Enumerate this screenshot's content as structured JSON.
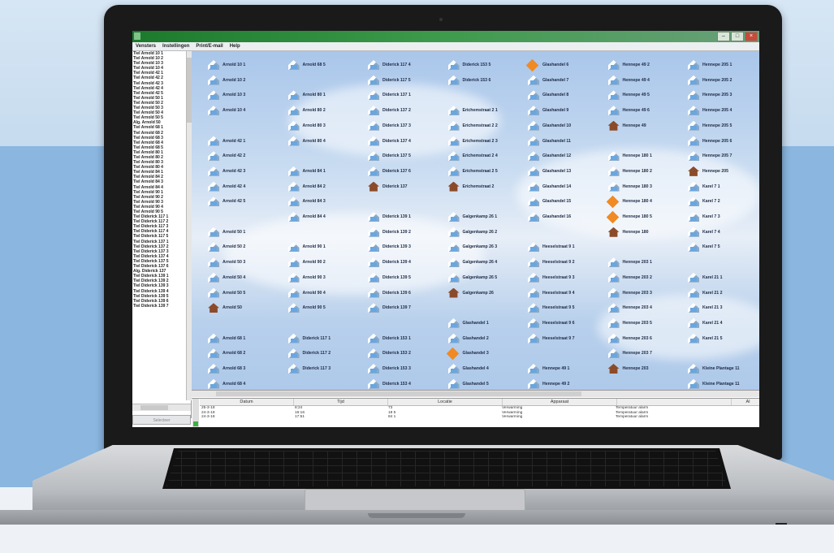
{
  "menu": [
    "Vensters",
    "Instellingen",
    "Print/E-mail",
    "Help"
  ],
  "sidebar": {
    "items": [
      "Tiel Arnold 10 1",
      "Tiel Arnold 10 2",
      "Tiel Arnold 10 3",
      "Tiel Arnold 10 4",
      "Tiel Arnold 42 1",
      "Tiel Arnold 42 2",
      "Tiel Arnold 42 3",
      "Tiel Arnold 42 4",
      "Tiel Arnold 42 5",
      "Tiel Arnold 50 1",
      "Tiel Arnold 50 2",
      "Tiel Arnold 50 3",
      "Tiel Arnold 50 4",
      "Tiel Arnold 50 5",
      "Alg. Arnold 50",
      "Tiel Arnold 68 1",
      "Tiel Arnold 68 2",
      "Tiel Arnold 68 3",
      "Tiel Arnold 68 4",
      "Tiel Arnold 68 5",
      "Tiel Arnold 80 1",
      "Tiel Arnold 80 2",
      "Tiel Arnold 80 3",
      "Tiel Arnold 80 4",
      "Tiel Arnold 84 1",
      "Tiel Arnold 84 2",
      "Tiel Arnold 84 3",
      "Tiel Arnold 84 4",
      "Tiel Arnold 90 1",
      "Tiel Arnold 90 2",
      "Tiel Arnold 90 3",
      "Tiel Arnold 90 4",
      "Tiel Arnold 90 5",
      "Tiel Diderick 117 1",
      "Tiel Diderick 117 2",
      "Tiel Diderick 117 3",
      "Tiel Diderick 117 4",
      "Tiel Diderick 117 5",
      "Tiel Diderick 137 1",
      "Tiel Diderick 137 2",
      "Tiel Diderick 137 3",
      "Tiel Diderick 137 4",
      "Tiel Diderick 137 5",
      "Tiel Diderick 137 6",
      "Alg. Diderick 137",
      "Tiel Diderick 139 1",
      "Tiel Diderick 139 2",
      "Tiel Diderick 139 3",
      "Tiel Diderick 139 4",
      "Tiel Diderick 139 5",
      "Tiel Diderick 139 6",
      "Tiel Diderick 139 7"
    ],
    "select_button": "Selecteer"
  },
  "grid": {
    "columns": [
      {
        "cells": [
          {
            "label": "Arnold 10 1",
            "icon": "roof-icon"
          },
          {
            "label": "Arnold 10 2",
            "icon": "roof-icon"
          },
          {
            "label": "Arnold 10 3",
            "icon": "roof-icon"
          },
          {
            "label": "Arnold 10 4",
            "icon": "roof-icon"
          },
          {
            "label": "",
            "icon": ""
          },
          {
            "label": "Arnold 42 1",
            "icon": "roof-icon"
          },
          {
            "label": "Arnold 42 2",
            "icon": "roof-icon"
          },
          {
            "label": "Arnold 42 3",
            "icon": "roof-icon"
          },
          {
            "label": "Arnold 42 4",
            "icon": "roof-icon"
          },
          {
            "label": "Arnold 42 5",
            "icon": "roof-icon"
          },
          {
            "label": "",
            "icon": ""
          },
          {
            "label": "Arnold 50 1",
            "icon": "roof-icon"
          },
          {
            "label": "Arnold 50 2",
            "icon": "roof-icon"
          },
          {
            "label": "Arnold 50 3",
            "icon": "roof-icon"
          },
          {
            "label": "Arnold 50 4",
            "icon": "roof-icon"
          },
          {
            "label": "Arnold 50 5",
            "icon": "roof-icon"
          },
          {
            "label": "Arnold 50",
            "icon": "house-icon"
          },
          {
            "label": "",
            "icon": ""
          },
          {
            "label": "Arnold 68 1",
            "icon": "roof-icon"
          },
          {
            "label": "Arnold 68 2",
            "icon": "roof-icon"
          },
          {
            "label": "Arnold 68 3",
            "icon": "roof-icon"
          },
          {
            "label": "Arnold 68 4",
            "icon": "roof-icon"
          }
        ]
      },
      {
        "cells": [
          {
            "label": "Arnold 68 5",
            "icon": "roof-icon"
          },
          {
            "label": "",
            "icon": ""
          },
          {
            "label": "Arnold 80 1",
            "icon": "roof-icon"
          },
          {
            "label": "Arnold 80 2",
            "icon": "roof-icon"
          },
          {
            "label": "Arnold 80 3",
            "icon": "roof-icon"
          },
          {
            "label": "Arnold 80 4",
            "icon": "roof-icon"
          },
          {
            "label": "",
            "icon": ""
          },
          {
            "label": "Arnold 84 1",
            "icon": "roof-icon"
          },
          {
            "label": "Arnold 84 2",
            "icon": "roof-icon"
          },
          {
            "label": "Arnold 84 3",
            "icon": "roof-icon"
          },
          {
            "label": "Arnold 84 4",
            "icon": "roof-icon"
          },
          {
            "label": "",
            "icon": ""
          },
          {
            "label": "Arnold 90 1",
            "icon": "roof-icon"
          },
          {
            "label": "Arnold 90 2",
            "icon": "roof-icon"
          },
          {
            "label": "Arnold 90 3",
            "icon": "roof-icon"
          },
          {
            "label": "Arnold 90 4",
            "icon": "roof-icon"
          },
          {
            "label": "Arnold 90 5",
            "icon": "roof-icon"
          },
          {
            "label": "",
            "icon": ""
          },
          {
            "label": "Diderick 117 1",
            "icon": "roof-icon"
          },
          {
            "label": "Diderick 117 2",
            "icon": "roof-icon"
          },
          {
            "label": "Diderick 117 3",
            "icon": "roof-icon"
          }
        ]
      },
      {
        "cells": [
          {
            "label": "Diderick 117 4",
            "icon": "roof-icon"
          },
          {
            "label": "Diderick 117 5",
            "icon": "roof-icon"
          },
          {
            "label": "Diderick 137 1",
            "icon": "roof-icon"
          },
          {
            "label": "Diderick 137 2",
            "icon": "roof-icon"
          },
          {
            "label": "Diderick 137 3",
            "icon": "roof-icon"
          },
          {
            "label": "Diderick 137 4",
            "icon": "roof-icon"
          },
          {
            "label": "Diderick 137 5",
            "icon": "roof-icon"
          },
          {
            "label": "Diderick 137 6",
            "icon": "roof-icon"
          },
          {
            "label": "Diderick 137",
            "icon": "house-icon"
          },
          {
            "label": "",
            "icon": ""
          },
          {
            "label": "Diderick 139 1",
            "icon": "roof-icon"
          },
          {
            "label": "Diderick 139 2",
            "icon": "roof-icon"
          },
          {
            "label": "Diderick 139 3",
            "icon": "roof-icon"
          },
          {
            "label": "Diderick 139 4",
            "icon": "roof-icon"
          },
          {
            "label": "Diderick 139 5",
            "icon": "roof-icon"
          },
          {
            "label": "Diderick 139 6",
            "icon": "roof-icon"
          },
          {
            "label": "Diderick 139 7",
            "icon": "roof-icon"
          },
          {
            "label": "",
            "icon": ""
          },
          {
            "label": "Diderick 153 1",
            "icon": "roof-icon"
          },
          {
            "label": "Diderick 153 2",
            "icon": "roof-icon"
          },
          {
            "label": "Diderick 153 3",
            "icon": "roof-icon"
          },
          {
            "label": "Diderick 153 4",
            "icon": "roof-icon"
          }
        ]
      },
      {
        "cells": [
          {
            "label": "Diderick 153 5",
            "icon": "roof-icon"
          },
          {
            "label": "Diderick 153 6",
            "icon": "roof-icon"
          },
          {
            "label": "",
            "icon": ""
          },
          {
            "label": "Erichemstraat 2 1",
            "icon": "roof-icon"
          },
          {
            "label": "Erichemstraat 2 2",
            "icon": "roof-icon"
          },
          {
            "label": "Erichemstraat 2 3",
            "icon": "roof-icon"
          },
          {
            "label": "Erichemstraat 2 4",
            "icon": "roof-icon"
          },
          {
            "label": "Erichemstraat 2 5",
            "icon": "roof-icon"
          },
          {
            "label": "Erichemstraat 2",
            "icon": "house-icon"
          },
          {
            "label": "",
            "icon": ""
          },
          {
            "label": "Galgenkamp 26 1",
            "icon": "roof-icon"
          },
          {
            "label": "Galgenkamp 26 2",
            "icon": "roof-icon"
          },
          {
            "label": "Galgenkamp 26 3",
            "icon": "roof-icon"
          },
          {
            "label": "Galgenkamp 26 4",
            "icon": "roof-icon"
          },
          {
            "label": "Galgenkamp 26 5",
            "icon": "roof-icon"
          },
          {
            "label": "Galgenkamp 26",
            "icon": "house-icon"
          },
          {
            "label": "",
            "icon": ""
          },
          {
            "label": "Glashandel 1",
            "icon": "roof-icon"
          },
          {
            "label": "Glashandel 2",
            "icon": "roof-icon"
          },
          {
            "label": "Glashandel 3",
            "icon": "alarm-icon"
          },
          {
            "label": "Glashandel 4",
            "icon": "roof-icon"
          },
          {
            "label": "Glashandel 5",
            "icon": "roof-icon"
          }
        ]
      },
      {
        "cells": [
          {
            "label": "Glashandel 6",
            "icon": "alarm-icon"
          },
          {
            "label": "Glashandel 7",
            "icon": "roof-icon"
          },
          {
            "label": "Glashandel 8",
            "icon": "roof-icon"
          },
          {
            "label": "Glashandel 9",
            "icon": "roof-icon"
          },
          {
            "label": "Glashandel 10",
            "icon": "roof-icon"
          },
          {
            "label": "Glashandel 11",
            "icon": "roof-icon"
          },
          {
            "label": "Glashandel 12",
            "icon": "roof-icon"
          },
          {
            "label": "Glashandel 13",
            "icon": "roof-icon"
          },
          {
            "label": "Glashandel 14",
            "icon": "roof-icon"
          },
          {
            "label": "Glashandel 15",
            "icon": "roof-icon"
          },
          {
            "label": "Glashandel 16",
            "icon": "roof-icon"
          },
          {
            "label": "",
            "icon": ""
          },
          {
            "label": "Heeselstraat 9 1",
            "icon": "roof-icon"
          },
          {
            "label": "Heeselstraat 9 2",
            "icon": "roof-icon"
          },
          {
            "label": "Heeselstraat 9 3",
            "icon": "roof-icon"
          },
          {
            "label": "Heeselstraat 9 4",
            "icon": "roof-icon"
          },
          {
            "label": "Heeselstraat 9 5",
            "icon": "roof-icon"
          },
          {
            "label": "Heeselstraat 9 6",
            "icon": "roof-icon"
          },
          {
            "label": "Heeselstraat 9 7",
            "icon": "roof-icon"
          },
          {
            "label": "",
            "icon": ""
          },
          {
            "label": "Hennepe 49 1",
            "icon": "roof-icon"
          },
          {
            "label": "Hennepe 49 2",
            "icon": "roof-icon"
          }
        ]
      },
      {
        "cells": [
          {
            "label": "Hennepe 49 2",
            "icon": "roof-icon"
          },
          {
            "label": "Hennepe 49 4",
            "icon": "roof-icon"
          },
          {
            "label": "Hennepe 49 5",
            "icon": "roof-icon"
          },
          {
            "label": "Hennepe 49 6",
            "icon": "roof-icon"
          },
          {
            "label": "Hennepe 49",
            "icon": "house-icon"
          },
          {
            "label": "",
            "icon": ""
          },
          {
            "label": "Hennepe 180 1",
            "icon": "roof-icon"
          },
          {
            "label": "Hennepe 180 2",
            "icon": "roof-icon"
          },
          {
            "label": "Hennepe 180 3",
            "icon": "roof-icon"
          },
          {
            "label": "Hennepe 180 4",
            "icon": "alarm-icon"
          },
          {
            "label": "Hennepe 180 5",
            "icon": "alarm-icon"
          },
          {
            "label": "Hennepe 180",
            "icon": "house-icon"
          },
          {
            "label": "",
            "icon": ""
          },
          {
            "label": "Hennepe 203 1",
            "icon": "roof-icon"
          },
          {
            "label": "Hennepe 203 2",
            "icon": "roof-icon"
          },
          {
            "label": "Hennepe 203 3",
            "icon": "roof-icon"
          },
          {
            "label": "Hennepe 203 4",
            "icon": "roof-icon"
          },
          {
            "label": "Hennepe 203 5",
            "icon": "roof-icon"
          },
          {
            "label": "Hennepe 203 6",
            "icon": "roof-icon"
          },
          {
            "label": "Hennepe 203 7",
            "icon": "roof-icon"
          },
          {
            "label": "Hennepe 203",
            "icon": "house-icon"
          }
        ]
      },
      {
        "cells": [
          {
            "label": "Hennepe 205 1",
            "icon": "roof-icon"
          },
          {
            "label": "Hennepe 205 2",
            "icon": "roof-icon"
          },
          {
            "label": "Hennepe 205 3",
            "icon": "roof-icon"
          },
          {
            "label": "Hennepe 205 4",
            "icon": "roof-icon"
          },
          {
            "label": "Hennepe 205 5",
            "icon": "roof-icon"
          },
          {
            "label": "Hennepe 205 6",
            "icon": "roof-icon"
          },
          {
            "label": "Hennepe 205 7",
            "icon": "roof-icon"
          },
          {
            "label": "Hennepe 205",
            "icon": "house-icon"
          },
          {
            "label": "Karel 7 1",
            "icon": "roof-icon"
          },
          {
            "label": "Karel 7 2",
            "icon": "roof-icon"
          },
          {
            "label": "Karel 7 3",
            "icon": "roof-icon"
          },
          {
            "label": "Karel 7 4",
            "icon": "roof-icon"
          },
          {
            "label": "Karel 7 5",
            "icon": "roof-icon"
          },
          {
            "label": "",
            "icon": ""
          },
          {
            "label": "Karel 21 1",
            "icon": "roof-icon"
          },
          {
            "label": "Karel 21 2",
            "icon": "roof-icon"
          },
          {
            "label": "Karel 21 3",
            "icon": "roof-icon"
          },
          {
            "label": "Karel 21 4",
            "icon": "roof-icon"
          },
          {
            "label": "Karel 21 5",
            "icon": "roof-icon"
          },
          {
            "label": "",
            "icon": ""
          },
          {
            "label": "Kleine Plantage 11",
            "icon": "roof-icon"
          },
          {
            "label": "Kleine Plantage 11",
            "icon": "roof-icon"
          }
        ]
      }
    ]
  },
  "alarm_table": {
    "headers": [
      "Datum",
      "Tijd",
      "Locatie",
      "Apparaat",
      "",
      "Al"
    ],
    "rows": [
      [
        "25-3-18",
        "8:24",
        "73",
        "Verwarming",
        "Temperatuur alarm"
      ],
      [
        "24-3-18",
        "16:16",
        "18 5",
        "Verwarming",
        "Temperatuur alarm"
      ],
      [
        "24-3-18",
        "17:51",
        "84 1",
        "Verwarming",
        "Temperatuur alarm"
      ]
    ]
  },
  "colors": {
    "titlebar": "#1b7a2c",
    "alarm": "#f08a24",
    "house": "#8b4b2a",
    "status_ok": "#3cb043"
  }
}
